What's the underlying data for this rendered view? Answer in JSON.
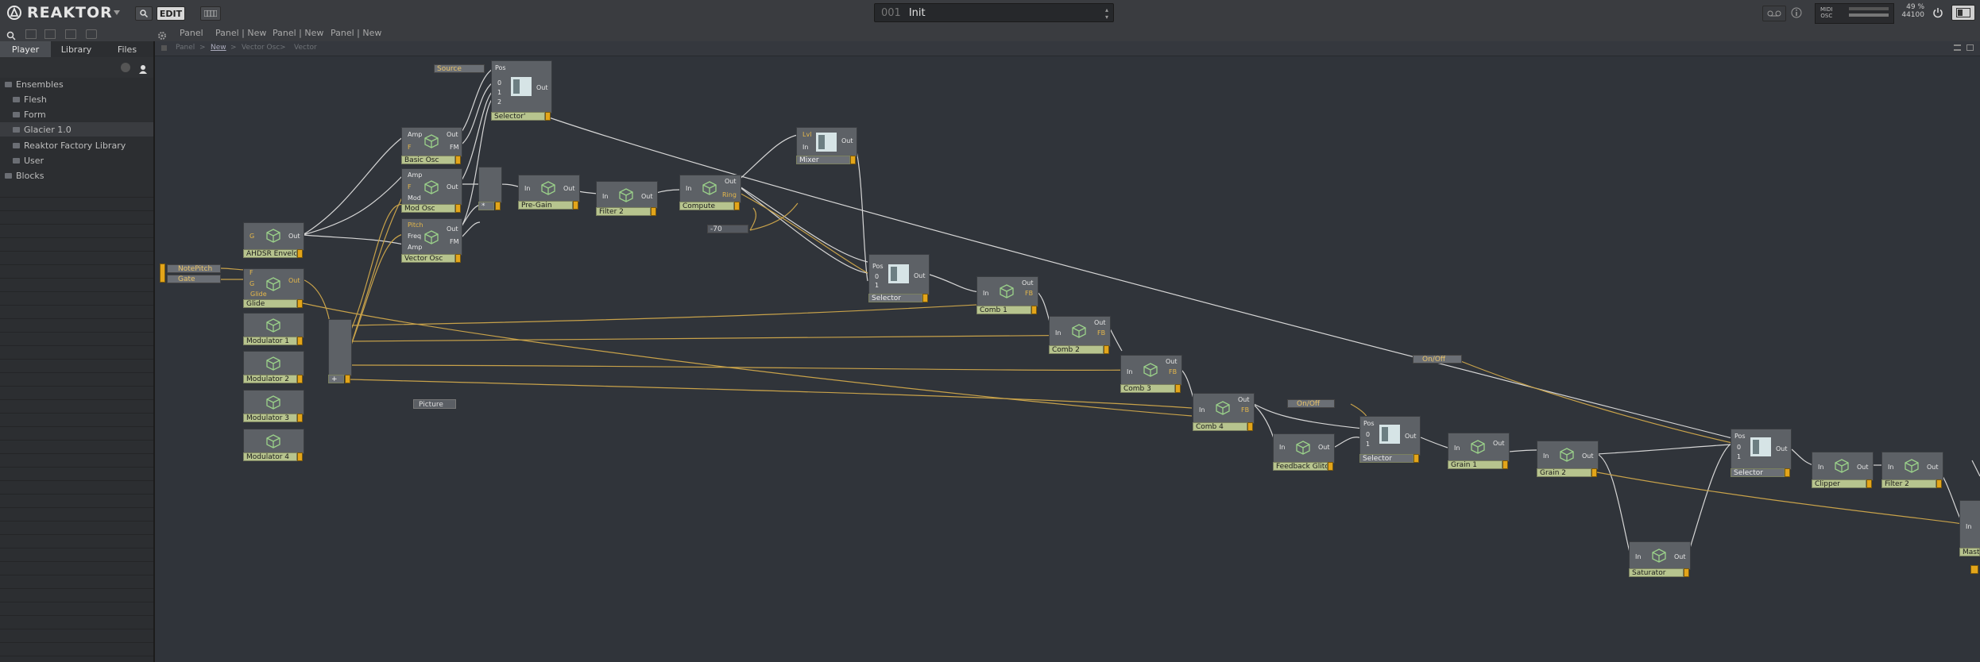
{
  "app": {
    "name": "REAKTOR",
    "edit_label": "EDIT"
  },
  "preset": {
    "number": "001",
    "name": "Init"
  },
  "top_right": {
    "midi": "MIDI",
    "osc": "OSC",
    "cpu": "49 %",
    "rate": "44100"
  },
  "panel_tabs": [
    "Panel",
    "Panel | New",
    "Panel | New",
    "Panel | New"
  ],
  "browser_tabs": [
    "Player",
    "Library",
    "Files"
  ],
  "tree": [
    {
      "label": "Ensembles",
      "indent": 0
    },
    {
      "label": "Flesh",
      "indent": 1
    },
    {
      "label": "Form",
      "indent": 1
    },
    {
      "label": "Glacier 1.0",
      "indent": 1
    },
    {
      "label": "Reaktor Factory Library",
      "indent": 1
    },
    {
      "label": "User",
      "indent": 1
    },
    {
      "label": "Blocks",
      "indent": 0
    }
  ],
  "breadcrumb": [
    "Panel",
    "New",
    "Vector Osc",
    "Vector"
  ],
  "modules": {
    "source": "Source",
    "selector_top": "Selector'",
    "basic_osc": "Basic Osc",
    "mod_osc": "Mod Osc",
    "vector_osc": "Vector Osc",
    "pre_gain": "Pre-Gain",
    "filter2a": "Filter 2",
    "compute": "Compute",
    "mixer": "Mixer",
    "const_val": "-70",
    "envelope": "AHDSR Envelope",
    "note_pitch": "NotePitch",
    "gate": "Gate",
    "glide": "Glide",
    "mod1": "Modulator 1",
    "mod2": "Modulator 2",
    "mod3": "Modulator 3",
    "mod4": "Modulator 4",
    "picture": "Picture",
    "selector_mid": "Selector",
    "comb1": "Comb 1",
    "comb2": "Comb 2",
    "comb3": "Comb 3",
    "comb4": "Comb 4",
    "onoff1": "On/Off",
    "onoff2": "On/Off",
    "feedback_glitch": "Feedback Glitch",
    "selector_3": "Selector",
    "grain1": "Grain 1",
    "grain2": "Grain 2",
    "saturator": "Saturator",
    "selector_4": "Selector",
    "clipper": "Clipper",
    "filter2b": "Filter 2",
    "master": "Mast"
  },
  "ports": {
    "pos": "Pos",
    "in": "In",
    "out": "Out",
    "zero": "0",
    "one": "1",
    "two": "2",
    "amp": "Amp",
    "f": "F",
    "fm": "FM",
    "mod": "Mod",
    "freq": "Freq",
    "pitch": "Pitch",
    "g": "G",
    "glide": "Glide",
    "ring": "Ring",
    "fb": "FB",
    "lvl": "Lvl",
    "star": "*",
    "plus": "+"
  },
  "colors": {
    "accent": "#e3a51a",
    "label_bg": "#b7c48e",
    "wire_white": "#d6d6d6",
    "wire_orange": "#c8a24a",
    "canvas": "#30343a"
  }
}
